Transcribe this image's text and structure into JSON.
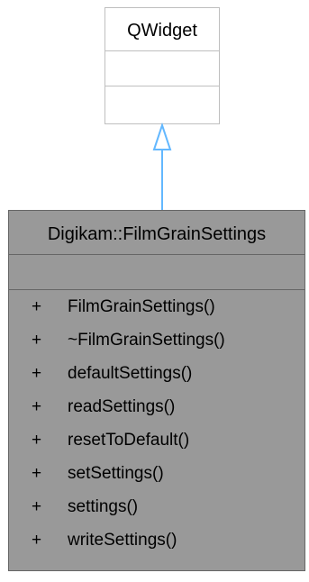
{
  "base_class": {
    "name": "QWidget",
    "attributes": [],
    "operations": []
  },
  "derived_class": {
    "name": "Digikam::FilmGrainSettings",
    "attributes": [],
    "operations": [
      {
        "visibility": "+",
        "name": "FilmGrainSettings()"
      },
      {
        "visibility": "+",
        "name": "~FilmGrainSettings()"
      },
      {
        "visibility": "+",
        "name": "defaultSettings()"
      },
      {
        "visibility": "+",
        "name": "readSettings()"
      },
      {
        "visibility": "+",
        "name": "resetToDefault()"
      },
      {
        "visibility": "+",
        "name": "setSettings()"
      },
      {
        "visibility": "+",
        "name": "settings()"
      },
      {
        "visibility": "+",
        "name": "writeSettings()"
      }
    ]
  },
  "relationship": {
    "type": "inheritance",
    "from": "Digikam::FilmGrainSettings",
    "to": "QWidget"
  },
  "colors": {
    "base_fill": "#ffffff",
    "base_border": "#bfbfbf",
    "derived_fill": "#999999",
    "derived_border": "#666666",
    "arrow": "#63b8ff",
    "text": "#000000"
  }
}
